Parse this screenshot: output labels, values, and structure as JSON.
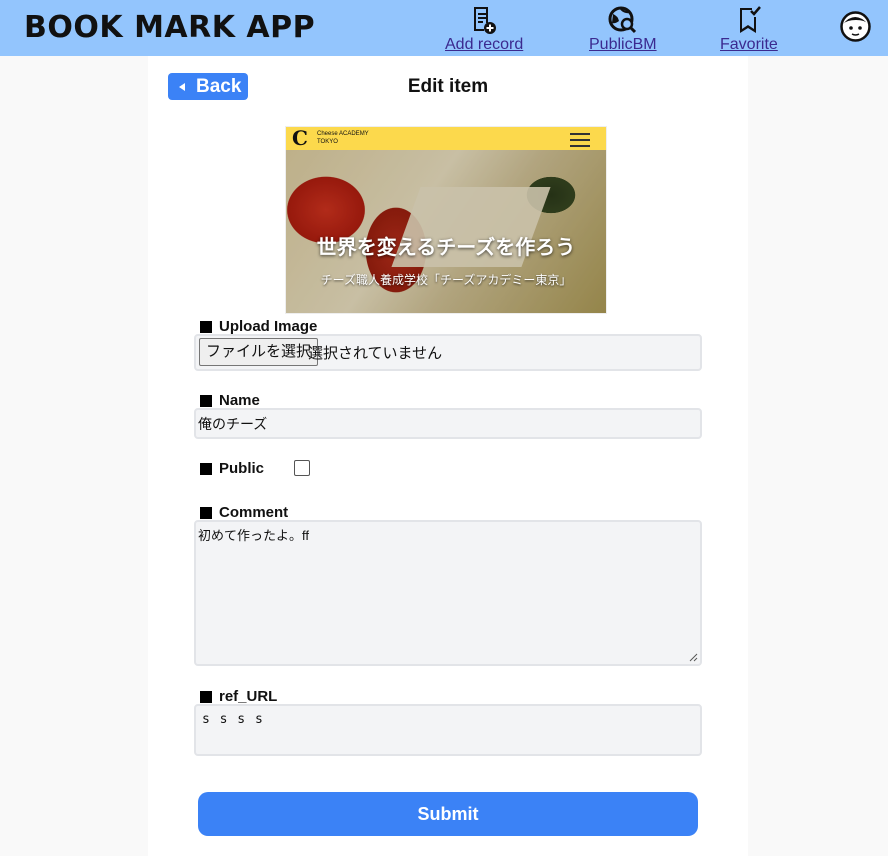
{
  "header": {
    "app_title": "BOOK MARK APP",
    "nav": [
      {
        "label": "Add record",
        "icon": "add-record-icon"
      },
      {
        "label": "PublicBM",
        "icon": "public-search-icon"
      },
      {
        "label": "Favorite",
        "icon": "bookmark-check-icon"
      }
    ],
    "avatar_icon": "user-avatar-icon"
  },
  "page": {
    "back_label": "Back",
    "title": "Edit item"
  },
  "preview": {
    "logo_letter": "C",
    "logo_line1": "Cheese ACADEMY",
    "logo_line2": "TOKYO",
    "headline": "世界を変えるチーズを作ろう",
    "subline": "チーズ職人養成学校「チーズアカデミー東京」"
  },
  "form": {
    "upload_label": "Upload Image",
    "file_button": "ファイルを選択",
    "file_status": "選択されていません",
    "name_label": "Name",
    "name_value": "俺のチーズ",
    "public_label": "Public",
    "public_checked": false,
    "comment_label": "Comment",
    "comment_value": "初めて作ったよ。ff",
    "url_label": "ref_URL",
    "url_value": "s s s s",
    "submit_label": "Submit"
  },
  "colors": {
    "header_bg": "#93c5fd",
    "accent": "#3b82f6",
    "link": "#3b2a8f"
  }
}
